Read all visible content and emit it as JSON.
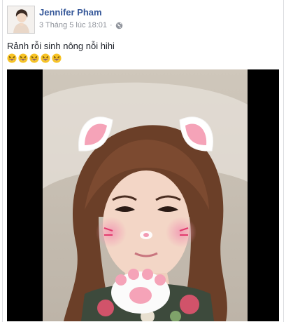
{
  "post": {
    "author": "Jennifer Pham",
    "timestamp": "3 Tháng 5 lúc 18:01",
    "audience_icon": "globe-icon",
    "caption": "Rảnh rỗi sinh nông nỗi hihi",
    "emoji_icon": "grinning-squinting-face",
    "emoji_count": 5
  },
  "video": {
    "filter": "cat-ears-and-paws",
    "letterbox_color": "#000000"
  },
  "colors": {
    "author_link": "#365899",
    "meta_text": "#90949c",
    "body_text": "#1d2129",
    "border": "#dddfe2"
  }
}
